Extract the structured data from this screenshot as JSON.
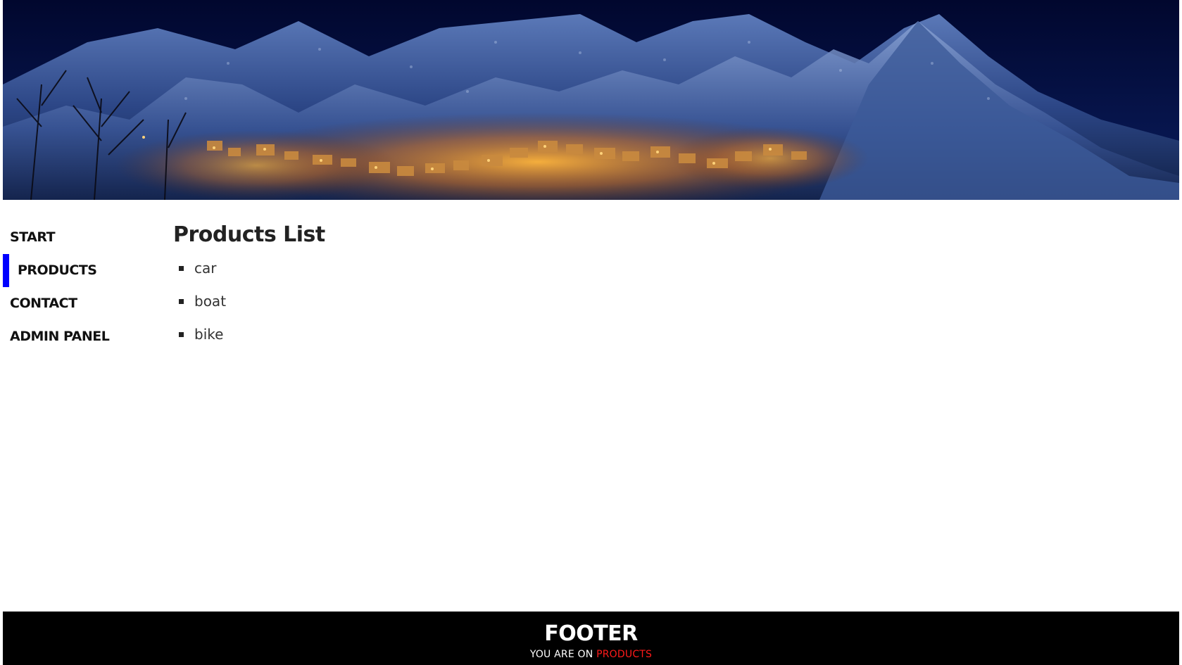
{
  "header": {
    "image_alt": "Night mountain village header image"
  },
  "sidebar": {
    "items": [
      {
        "label": "START",
        "active": false
      },
      {
        "label": "PRODUCTS",
        "active": true
      },
      {
        "label": "CONTACT",
        "active": false
      },
      {
        "label": "ADMIN PANEL",
        "active": false
      }
    ],
    "active_color": "#0000ff"
  },
  "main": {
    "title": "Products List",
    "products": [
      "car",
      "boat",
      "bike"
    ]
  },
  "footer": {
    "title": "FOOTER",
    "location_prefix": "YOU ARE ON",
    "current_page": "PRODUCTS",
    "current_page_color": "#ff1a1a",
    "background": "#000000"
  }
}
